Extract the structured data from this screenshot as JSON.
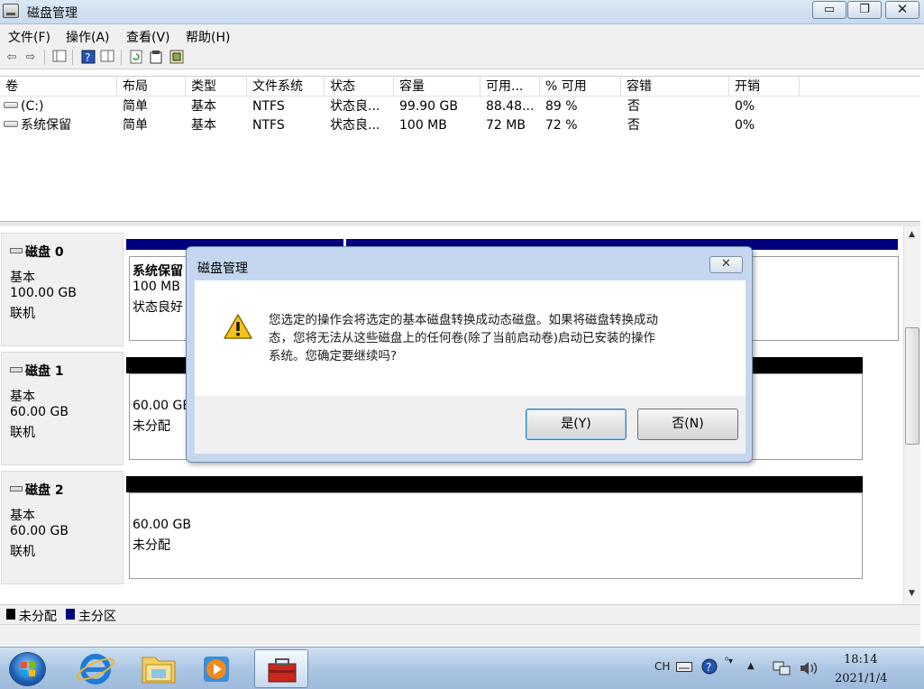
{
  "window": {
    "title": "磁盘管理",
    "min_glyph": "▭",
    "max_glyph": "❐",
    "close_glyph": "✕"
  },
  "menu": [
    "文件(F)",
    "操作(A)",
    "查看(V)",
    "帮助(H)"
  ],
  "toolbar": {
    "icons": [
      "back-arrow-icon",
      "forward-arrow-icon",
      "console-tree-icon",
      "help-icon",
      "details-pane-icon",
      "refresh-icon",
      "properties-icon",
      "action-pane-icon"
    ]
  },
  "volumes": {
    "columns": [
      "卷",
      "布局",
      "类型",
      "文件系统",
      "状态",
      "容量",
      "可用...",
      "% 可用",
      "容错",
      "开销"
    ],
    "rows": [
      [
        "(C:)",
        "简单",
        "基本",
        "NTFS",
        "状态良...",
        "99.90 GB",
        "88.48...",
        "89 %",
        "否",
        "0%"
      ],
      [
        "系统保留",
        "简单",
        "基本",
        "NTFS",
        "状态良...",
        "100 MB",
        "72 MB",
        "72 %",
        "否",
        "0%"
      ]
    ]
  },
  "disks": [
    {
      "name": "磁盘 0",
      "type": "基本",
      "size": "100.00 GB",
      "status": "联机",
      "partitions": [
        {
          "name": "系统保留",
          "size": "100 MB",
          "status": "状态良好"
        }
      ]
    },
    {
      "name": "磁盘 1",
      "type": "基本",
      "size": "60.00 GB",
      "status": "联机",
      "partitions": [
        {
          "size": "60.00 GB",
          "status": "未分配"
        }
      ]
    },
    {
      "name": "磁盘 2",
      "type": "基本",
      "size": "60.00 GB",
      "status": "联机",
      "partitions": [
        {
          "size": "60.00 GB",
          "status": "未分配"
        }
      ]
    }
  ],
  "legend": [
    {
      "label": "未分配",
      "color": "#000000"
    },
    {
      "label": "主分区",
      "color": "#00007f"
    }
  ],
  "dialog": {
    "title": "磁盘管理",
    "close_glyph": "✕",
    "message_lines": [
      "您选定的操作会将选定的基本磁盘转换成动态磁盘。如果将磁盘转换成动",
      "态，您将无法从这些磁盘上的任何卷(除了当前启动卷)启动已安装的操作",
      "系统。您确定要继续吗?"
    ],
    "yes_label": "是(Y)",
    "no_label": "否(N)"
  },
  "taskbar": {
    "apps": [
      "start-orb",
      "internet-explorer-icon",
      "windows-explorer-icon",
      "media-player-icon",
      "disk-management-icon"
    ],
    "tray": {
      "lang": "CH"
    },
    "time": "18:14",
    "date": "2021/1/4"
  },
  "colors": {
    "primary_partition": "#00007f",
    "unallocated": "#000000",
    "titlebar": "#c9daee"
  }
}
